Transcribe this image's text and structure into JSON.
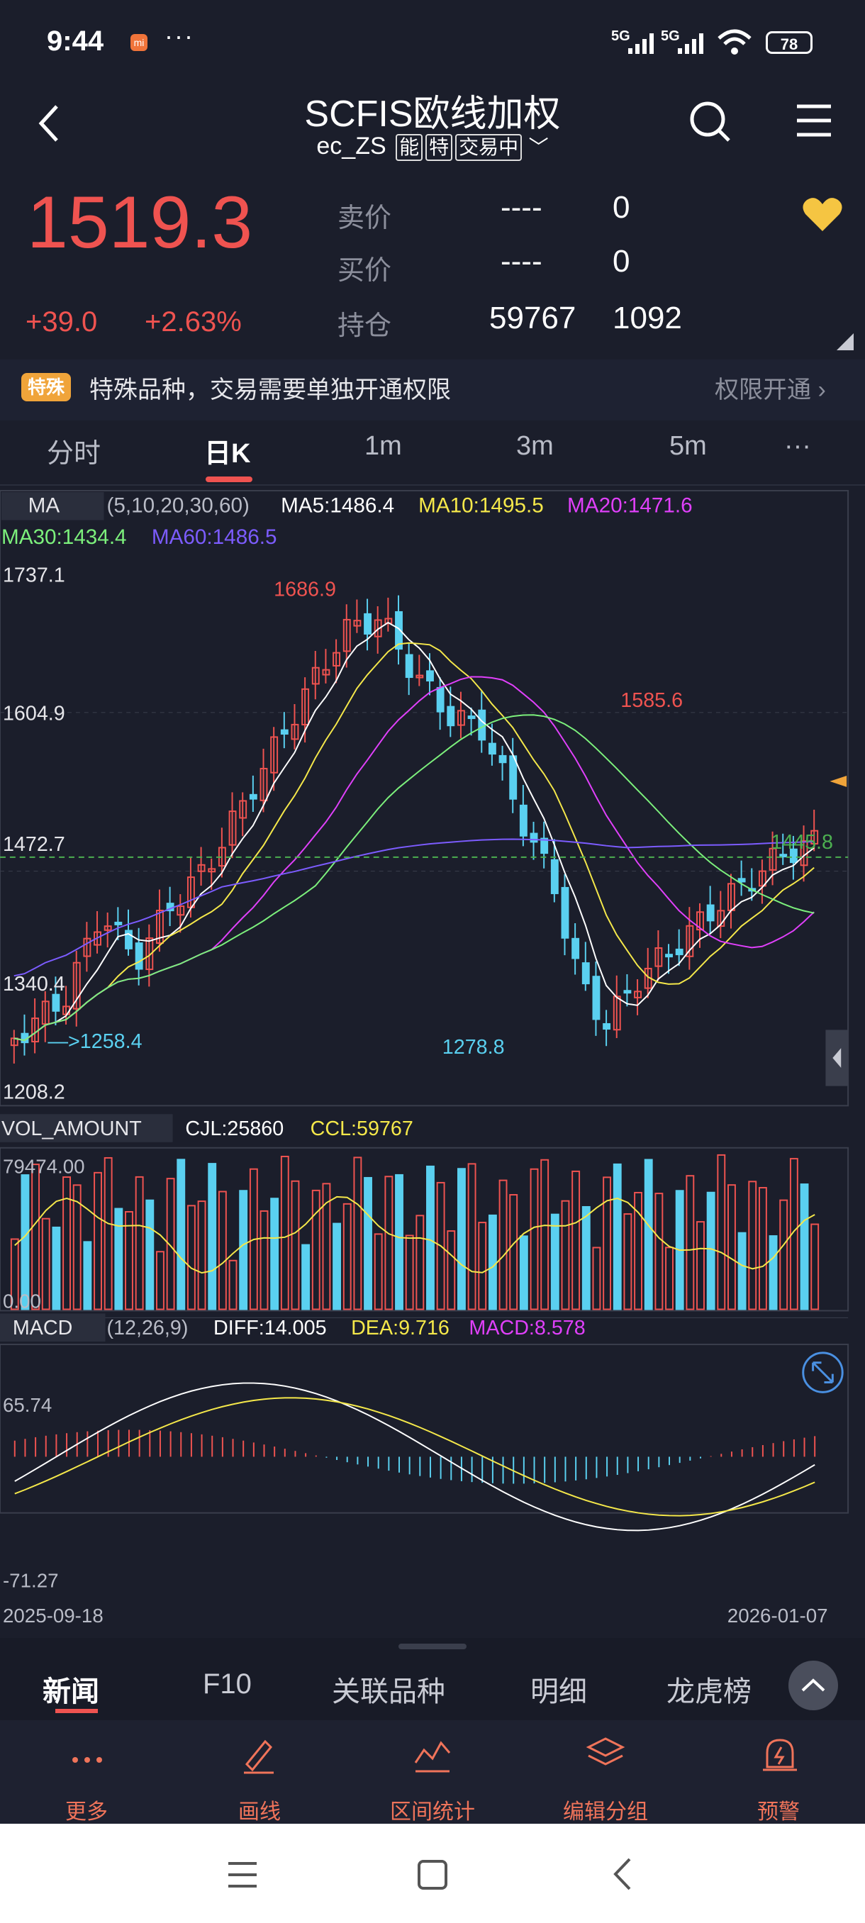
{
  "status": {
    "time": "9:44",
    "signal1": "5G",
    "signal2": "5G",
    "battery": "78"
  },
  "header": {
    "title": "SCFIS欧线加权",
    "code": "ec_ZS",
    "tag1": "能",
    "tag2": "特",
    "tag3": "交易中"
  },
  "quote": {
    "price": "1519.3",
    "change": "+39.0",
    "change_pct": "+2.63%",
    "sell_label": "卖价",
    "sell_price": "----",
    "sell_vol": "0",
    "buy_label": "买价",
    "buy_price": "----",
    "buy_vol": "0",
    "oi_label": "持仓",
    "oi_value": "59767",
    "oi_change": "1092"
  },
  "notice": {
    "badge": "特殊",
    "text": "特殊品种，交易需要单独开通权限",
    "link": "权限开通"
  },
  "tabs": [
    "分时",
    "日K",
    "1m",
    "3m",
    "5m",
    "···"
  ],
  "ma_bar": {
    "name": "MA",
    "params": "(5,10,20,30,60)",
    "ma5": "MA5:1486.4",
    "ma10": "MA10:1495.5",
    "ma20": "MA20:1471.6",
    "ma30": "MA30:1434.4",
    "ma60": "MA60:1486.5"
  },
  "price_axis": {
    "top": "1737.1",
    "mid1": "1604.9",
    "mid2": "1472.7",
    "mid3": "1340.4",
    "bottom": "1208.2"
  },
  "annotations": {
    "high": "1686.9",
    "low_left": "—>1258.4",
    "low": "1278.8",
    "peak2": "1585.6",
    "ref_line": "1445.8"
  },
  "vol_bar": {
    "name": "VOL_AMOUNT",
    "cjl": "CJL:25860",
    "ccl": "CCL:59767",
    "max": "79474.00",
    "min": "0.00"
  },
  "macd_bar": {
    "name": "MACD",
    "params": "(12,26,9)",
    "diff": "DIFF:14.005",
    "dea": "DEA:9.716",
    "macd": "MACD:8.578",
    "max": "65.74",
    "min": "-71.27"
  },
  "dates": {
    "start": "2025-09-18",
    "end": "2026-01-07"
  },
  "bottom_tabs": [
    "新闻",
    "F10",
    "关联品种",
    "明细",
    "龙虎榜"
  ],
  "toolbar": [
    "更多",
    "画线",
    "区间统计",
    "编辑分组",
    "预警"
  ],
  "colors": {
    "up": "#ef5350",
    "down": "#5ad0f0",
    "ma5": "#ffffff",
    "ma10": "#f5e84a",
    "ma20": "#e040fb",
    "ma30": "#7cf07c",
    "ma60": "#7c5cff"
  }
}
